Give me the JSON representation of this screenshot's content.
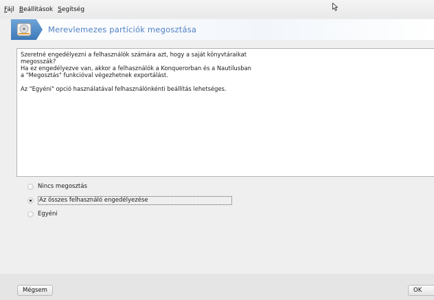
{
  "menubar": {
    "items": [
      {
        "accel": "F",
        "rest": "ájl"
      },
      {
        "accel": "B",
        "rest": "eállítások"
      },
      {
        "accel": "S",
        "rest": "egítség"
      }
    ]
  },
  "banner": {
    "title": "Merevlemezes partíciók megosztása"
  },
  "description": {
    "lines": [
      "Szeretné engedélyezni a felhasználók számára azt, hogy a saját könyvtáraikat",
      "megosszák?",
      "Ha ez engedélyezve van, akkor a felhasználók a Konquerorban és a Nautilusban",
      "a \"Megosztás\" funkcióval végezhetnek exportálást."
    ],
    "note": "Az \"Egyéni\" opció használatával felhasználónkénti beállítás lehetséges."
  },
  "options": [
    {
      "label": "Nincs megosztás",
      "checked": false
    },
    {
      "label": "Az összes felhasználó engedélyezése",
      "checked": true
    },
    {
      "label": "Egyéni",
      "checked": false
    }
  ],
  "buttons": {
    "cancel": "Mégsem",
    "ok": "OK"
  },
  "colors": {
    "banner_title": "#4f80c5",
    "logo_blue": "#3e79b9"
  }
}
